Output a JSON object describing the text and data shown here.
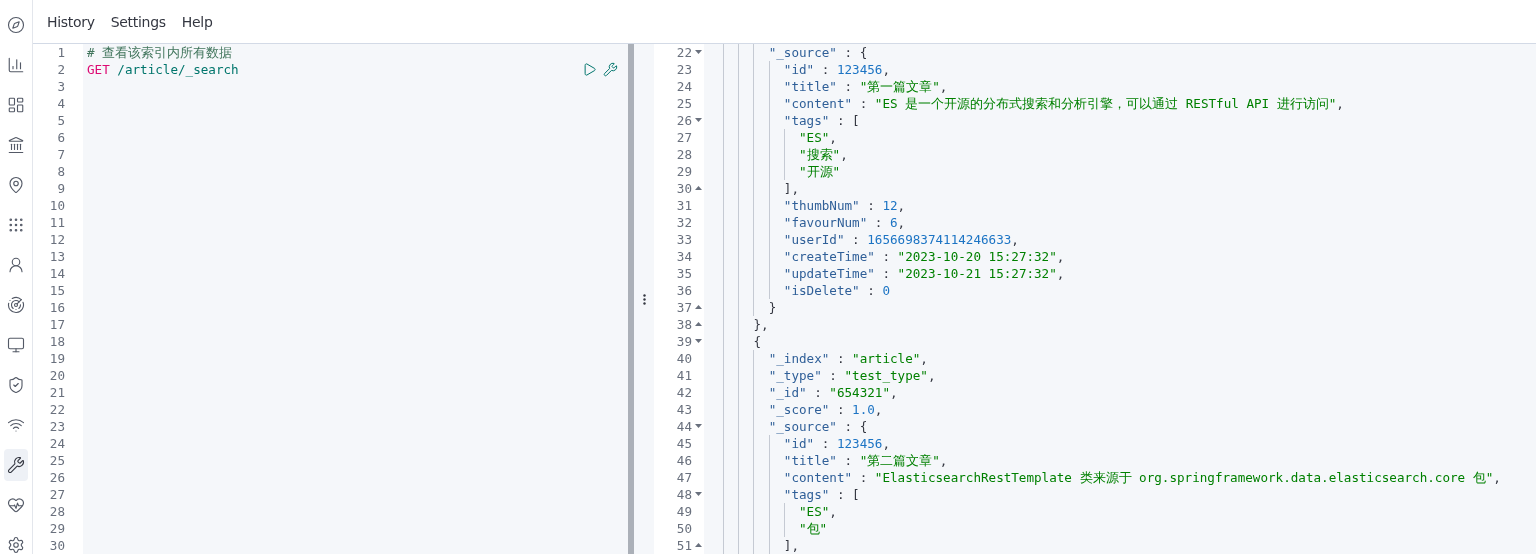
{
  "sidebar": {
    "items": [
      {
        "selected": false
      },
      {
        "selected": false
      },
      {
        "selected": false
      },
      {
        "selected": false
      },
      {
        "selected": false
      },
      {
        "selected": false
      },
      {
        "selected": false
      },
      {
        "selected": false
      },
      {
        "selected": false
      },
      {
        "selected": false
      },
      {
        "selected": false
      },
      {
        "selected": true
      },
      {
        "selected": false
      },
      {
        "selected": false
      }
    ]
  },
  "menu": [
    "History",
    "Settings",
    "Help"
  ],
  "request_editor": {
    "lines": [
      {
        "number": "1",
        "tokens": [
          {
            "kind": "comment",
            "t": "# 查看该索引内所有数据"
          }
        ]
      },
      {
        "number": "2",
        "tokens": [
          {
            "kind": "method",
            "t": "GET"
          },
          {
            "kind": "url",
            "t": " /article/_search"
          }
        ]
      },
      {
        "number": "3"
      },
      {
        "number": "4"
      },
      {
        "number": "5"
      },
      {
        "number": "6"
      },
      {
        "number": "7"
      },
      {
        "number": "8"
      },
      {
        "number": "9"
      },
      {
        "number": "10"
      },
      {
        "number": "11"
      },
      {
        "number": "12"
      },
      {
        "number": "13"
      },
      {
        "number": "14"
      },
      {
        "number": "15"
      },
      {
        "number": "16"
      },
      {
        "number": "17"
      },
      {
        "number": "18"
      },
      {
        "number": "19"
      },
      {
        "number": "20"
      },
      {
        "number": "21"
      },
      {
        "number": "22"
      },
      {
        "number": "23"
      },
      {
        "number": "24"
      },
      {
        "number": "25"
      },
      {
        "number": "26"
      },
      {
        "number": "27"
      },
      {
        "number": "28"
      },
      {
        "number": "29"
      },
      {
        "number": "30"
      }
    ]
  },
  "response_viewer": {
    "lines": [
      {
        "number": "22",
        "kind": "opener",
        "tokens": [
          {
            "kind": "key",
            "t": "        \"_source\""
          },
          {
            "kind": "punct",
            "t": " : {"
          }
        ]
      },
      {
        "number": "23",
        "kind": "plain",
        "tokens": [
          {
            "kind": "key",
            "t": "          \"id\""
          },
          {
            "kind": "punct",
            "t": " : "
          },
          {
            "kind": "number",
            "t": "123456"
          },
          {
            "kind": "punct",
            "t": ","
          }
        ]
      },
      {
        "number": "24",
        "kind": "plain",
        "tokens": [
          {
            "kind": "key",
            "t": "          \"title\""
          },
          {
            "kind": "punct",
            "t": " : "
          },
          {
            "kind": "string",
            "t": "\"第一篇文章\""
          },
          {
            "kind": "punct",
            "t": ","
          }
        ]
      },
      {
        "number": "25",
        "kind": "plain",
        "tokens": [
          {
            "kind": "key",
            "t": "          \"content\""
          },
          {
            "kind": "punct",
            "t": " : "
          },
          {
            "kind": "string",
            "t": "\"ES 是一个开源的分布式搜索和分析引擎，可以通过 RESTful API 进行访问\""
          },
          {
            "kind": "punct",
            "t": ","
          }
        ]
      },
      {
        "number": "26",
        "kind": "opener",
        "tokens": [
          {
            "kind": "key",
            "t": "          \"tags\""
          },
          {
            "kind": "punct",
            "t": " : ["
          }
        ]
      },
      {
        "number": "27",
        "kind": "plain",
        "tokens": [
          {
            "kind": "string",
            "t": "            \"ES\""
          },
          {
            "kind": "punct",
            "t": ","
          }
        ]
      },
      {
        "number": "28",
        "kind": "plain",
        "tokens": [
          {
            "kind": "string",
            "t": "            \"搜索\""
          },
          {
            "kind": "punct",
            "t": ","
          }
        ]
      },
      {
        "number": "29",
        "kind": "plain",
        "tokens": [
          {
            "kind": "string",
            "t": "            \"开源\""
          }
        ]
      },
      {
        "number": "30",
        "kind": "closer",
        "tokens": [
          {
            "kind": "punct",
            "t": "          ],"
          }
        ]
      },
      {
        "number": "31",
        "kind": "plain",
        "tokens": [
          {
            "kind": "key",
            "t": "          \"thumbNum\""
          },
          {
            "kind": "punct",
            "t": " : "
          },
          {
            "kind": "number",
            "t": "12"
          },
          {
            "kind": "punct",
            "t": ","
          }
        ]
      },
      {
        "number": "32",
        "kind": "plain",
        "tokens": [
          {
            "kind": "key",
            "t": "          \"favourNum\""
          },
          {
            "kind": "punct",
            "t": " : "
          },
          {
            "kind": "number",
            "t": "6"
          },
          {
            "kind": "punct",
            "t": ","
          }
        ]
      },
      {
        "number": "33",
        "kind": "plain",
        "tokens": [
          {
            "kind": "key",
            "t": "          \"userId\""
          },
          {
            "kind": "punct",
            "t": " : "
          },
          {
            "kind": "number",
            "t": "1656698374114246633"
          },
          {
            "kind": "punct",
            "t": ","
          }
        ]
      },
      {
        "number": "34",
        "kind": "plain",
        "tokens": [
          {
            "kind": "key",
            "t": "          \"createTime\""
          },
          {
            "kind": "punct",
            "t": " : "
          },
          {
            "kind": "string",
            "t": "\"2023-10-20 15:27:32\""
          },
          {
            "kind": "punct",
            "t": ","
          }
        ]
      },
      {
        "number": "35",
        "kind": "plain",
        "tokens": [
          {
            "kind": "key",
            "t": "          \"updateTime\""
          },
          {
            "kind": "punct",
            "t": " : "
          },
          {
            "kind": "string",
            "t": "\"2023-10-21 15:27:32\""
          },
          {
            "kind": "punct",
            "t": ","
          }
        ]
      },
      {
        "number": "36",
        "kind": "plain",
        "tokens": [
          {
            "kind": "key",
            "t": "          \"isDelete\""
          },
          {
            "kind": "punct",
            "t": " : "
          },
          {
            "kind": "number",
            "t": "0"
          }
        ]
      },
      {
        "number": "37",
        "kind": "closer",
        "tokens": [
          {
            "kind": "punct",
            "t": "        }"
          }
        ]
      },
      {
        "number": "38",
        "kind": "closer",
        "tokens": [
          {
            "kind": "punct",
            "t": "      },"
          }
        ]
      },
      {
        "number": "39",
        "kind": "opener",
        "tokens": [
          {
            "kind": "punct",
            "t": "      {"
          }
        ]
      },
      {
        "number": "40",
        "kind": "plain",
        "tokens": [
          {
            "kind": "key",
            "t": "        \"_index\""
          },
          {
            "kind": "punct",
            "t": " : "
          },
          {
            "kind": "string",
            "t": "\"article\""
          },
          {
            "kind": "punct",
            "t": ","
          }
        ]
      },
      {
        "number": "41",
        "kind": "plain",
        "tokens": [
          {
            "kind": "key",
            "t": "        \"_type\""
          },
          {
            "kind": "punct",
            "t": " : "
          },
          {
            "kind": "string",
            "t": "\"test_type\""
          },
          {
            "kind": "punct",
            "t": ","
          }
        ]
      },
      {
        "number": "42",
        "kind": "plain",
        "tokens": [
          {
            "kind": "key",
            "t": "        \"_id\""
          },
          {
            "kind": "punct",
            "t": " : "
          },
          {
            "kind": "string",
            "t": "\"654321\""
          },
          {
            "kind": "punct",
            "t": ","
          }
        ]
      },
      {
        "number": "43",
        "kind": "plain",
        "tokens": [
          {
            "kind": "key",
            "t": "        \"_score\""
          },
          {
            "kind": "punct",
            "t": " : "
          },
          {
            "kind": "number",
            "t": "1.0"
          },
          {
            "kind": "punct",
            "t": ","
          }
        ]
      },
      {
        "number": "44",
        "kind": "opener",
        "tokens": [
          {
            "kind": "key",
            "t": "        \"_source\""
          },
          {
            "kind": "punct",
            "t": " : {"
          }
        ]
      },
      {
        "number": "45",
        "kind": "plain",
        "tokens": [
          {
            "kind": "key",
            "t": "          \"id\""
          },
          {
            "kind": "punct",
            "t": " : "
          },
          {
            "kind": "number",
            "t": "123456"
          },
          {
            "kind": "punct",
            "t": ","
          }
        ]
      },
      {
        "number": "46",
        "kind": "plain",
        "tokens": [
          {
            "kind": "key",
            "t": "          \"title\""
          },
          {
            "kind": "punct",
            "t": " : "
          },
          {
            "kind": "string",
            "t": "\"第二篇文章\""
          },
          {
            "kind": "punct",
            "t": ","
          }
        ]
      },
      {
        "number": "47",
        "kind": "plain",
        "tokens": [
          {
            "kind": "key",
            "t": "          \"content\""
          },
          {
            "kind": "punct",
            "t": " : "
          },
          {
            "kind": "string",
            "t": "\"ElasticsearchRestTemplate 类来源于 org.springframework.data.elasticsearch.core 包\""
          },
          {
            "kind": "punct",
            "t": ","
          }
        ]
      },
      {
        "number": "48",
        "kind": "opener",
        "tokens": [
          {
            "kind": "key",
            "t": "          \"tags\""
          },
          {
            "kind": "punct",
            "t": " : ["
          }
        ]
      },
      {
        "number": "49",
        "kind": "plain",
        "tokens": [
          {
            "kind": "string",
            "t": "            \"ES\""
          },
          {
            "kind": "punct",
            "t": ","
          }
        ]
      },
      {
        "number": "50",
        "kind": "plain",
        "tokens": [
          {
            "kind": "string",
            "t": "            \"包\""
          }
        ]
      },
      {
        "number": "51",
        "kind": "closer",
        "tokens": [
          {
            "kind": "punct",
            "t": "          ],"
          }
        ]
      }
    ]
  }
}
